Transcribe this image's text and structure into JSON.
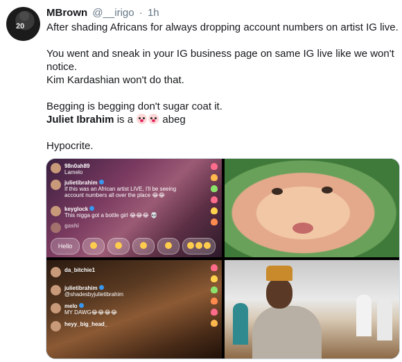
{
  "tweet": {
    "author_name": "MBrown",
    "handle": "@__irigo",
    "separator": "·",
    "time": "1h",
    "avatar_text": "20",
    "lines": [
      "After shading Africans for always dropping account numbers on artist IG live.",
      "You went and sneak in your IG business page on same IG live like we won't",
      "notice.",
      "Kim Kardashian won't do that.",
      "Begging is begging don't sugar coat it.",
      "Hypocrite."
    ],
    "mention": "Juliet Ibrahim",
    "mention_rest_pre": "is a",
    "mention_rest_post": "abeg"
  },
  "media": {
    "image1": {
      "comments": [
        {
          "user": "98n0ah89",
          "text": "Lamelo"
        },
        {
          "user": "julietibrahim",
          "verified": true,
          "text": "If this was an African artist LIVE, I'll be seeing",
          "text2": "account numbers all over the place 😂😂"
        },
        {
          "user": "keyglock",
          "verified": true,
          "text": "This nigga got a bottle girl 😂😂😂 💀"
        },
        {
          "user": "gashi",
          "text": ""
        }
      ],
      "reaction_hello": "Hello"
    },
    "image3": {
      "comments": [
        {
          "user": "da_bitchie1",
          "text": ""
        },
        {
          "user": "julietibrahim",
          "verified": true,
          "text": "@shadesbyjulietibrahim"
        },
        {
          "user": "melo",
          "verified": true,
          "text": "MY DAWG😂😂😂😂"
        },
        {
          "user": "heyy_big_head_",
          "text": ""
        }
      ]
    }
  },
  "colors": {
    "text": "#14171a",
    "meta": "#657786",
    "border": "#ccd6dd",
    "verified": "#3897f0"
  }
}
